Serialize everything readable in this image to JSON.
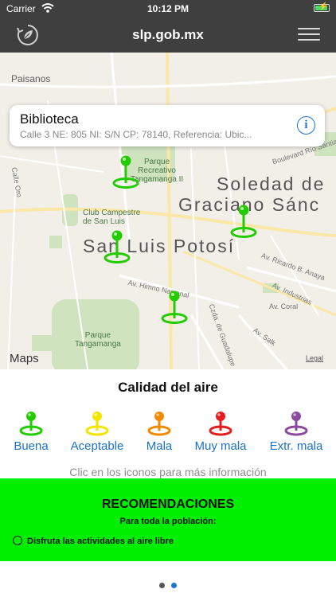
{
  "status_bar": {
    "carrier": "Carrier",
    "time": "10:12 PM"
  },
  "nav": {
    "title": "slp.gob.mx",
    "refresh_icon": "refresh-leaf-icon",
    "menu_icon": "hamburger-menu-icon"
  },
  "map": {
    "callout": {
      "title": "Biblioteca",
      "subtitle": "Calle 3 NE: 805 NI: S/N CP: 78140, Referencia: Ubic..."
    },
    "labels": {
      "paisanos": "Paisanos",
      "city1_line1": "Soledad de",
      "city1_line2": "Graciano Sánc",
      "city2": "San Luis Potosí",
      "park1": "Parque\nRecreativo\nTangamanga II",
      "park2": "Club Campestre\nde San Luis",
      "park3": "Parque\nTangamanga",
      "street_rio": "Boulevard Río Santiago",
      "street_oro": "Calle Oro",
      "street_anaya": "Av. Ricardo B. Anaya",
      "street_industrias": "Av. Industrias",
      "street_coral": "Av. Coral",
      "street_himno": "Av. Himno Nacional",
      "street_guadalupe": "Czda. de Guadalupe",
      "street_salk": "Av. Salk"
    },
    "maps_logo": "Maps",
    "legal": "Legal",
    "pin_color": "#22cc00"
  },
  "legend": {
    "title": "Calidad del aire",
    "items": [
      {
        "label": "Buena",
        "color": "#22cc00"
      },
      {
        "label": "Aceptable",
        "color": "#f2e600"
      },
      {
        "label": "Mala",
        "color": "#f08a00"
      },
      {
        "label": "Muy mala",
        "color": "#e61b1b"
      },
      {
        "label": "Extr. mala",
        "color": "#8a4a9e"
      }
    ],
    "hint": "Clic en los iconos para más información"
  },
  "recommendations": {
    "title": "RECOMENDACIONES",
    "subtitle": "Para toda la población:",
    "item": "Disfruta las actividades al aire libre",
    "background": "#00ee00"
  },
  "pager": {
    "page_count": 2,
    "current_page": 2
  }
}
